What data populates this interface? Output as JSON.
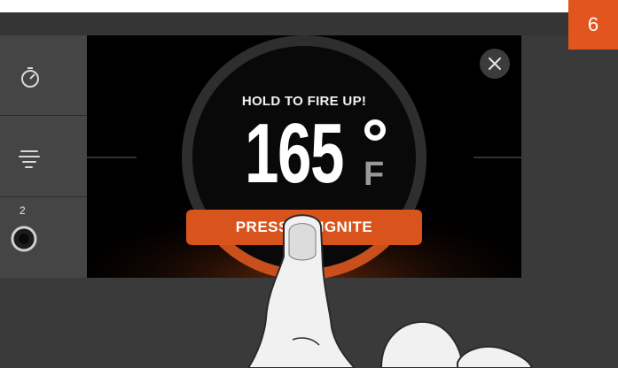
{
  "step_badge": "6",
  "sidebar": {
    "items": [
      {
        "icon": "timer-icon"
      },
      {
        "icon": "smoke-icon"
      },
      {
        "icon": "probe-port-icon",
        "label": "2"
      }
    ]
  },
  "dialog": {
    "heading": "HOLD TO FIRE UP!",
    "temperature": "165",
    "degree_symbol": "°",
    "unit": "F",
    "ignite_button": "PRESS TO IGNITE",
    "close_icon": "close-icon"
  },
  "colors": {
    "accent": "#e2551f",
    "button": "#d9541d",
    "screen": "#000000",
    "device": "#3a3a3a"
  }
}
